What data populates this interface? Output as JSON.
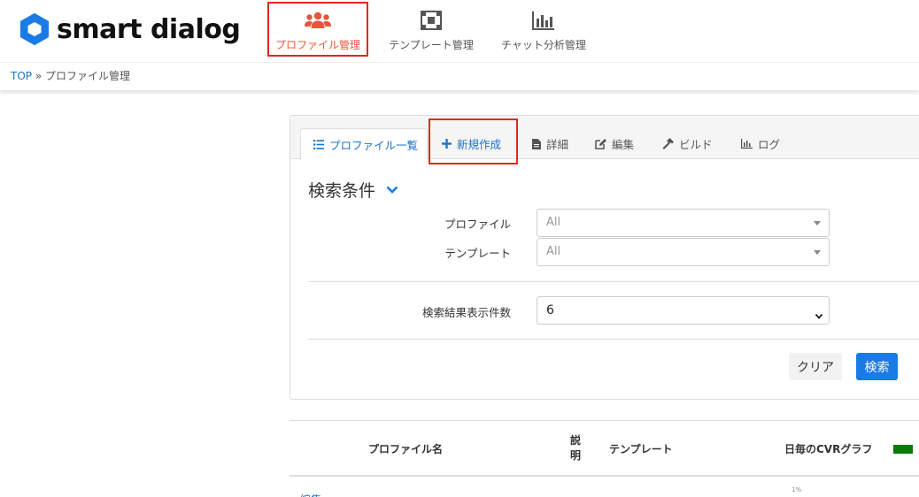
{
  "app": {
    "name": "smart dialog"
  },
  "nav": {
    "profile": "プロファイル管理",
    "template": "テンプレート管理",
    "chat": "チャット分析管理"
  },
  "breadcrumb": {
    "home": "TOP",
    "sep": "»",
    "current": "プロファイル管理"
  },
  "tabs": {
    "list": "プロファイル一覧",
    "new": "新規作成",
    "detail": "詳細",
    "edit": "編集",
    "build": "ビルド",
    "log": "ログ"
  },
  "search": {
    "title": "検索条件",
    "profile_label": "プロファイル",
    "profile_value": "All",
    "template_label": "テンプレート",
    "template_value": "All",
    "count_label": "検索結果表示件数",
    "count_value": "6",
    "clear_label": "クリア",
    "search_label": "検索"
  },
  "table": {
    "col_name": "プロファイル名",
    "col_desc": "説明",
    "col_template": "テンプレート",
    "col_graph": "日毎のCVRグラフ",
    "graph_pct": "1%",
    "row_edit": "編集"
  },
  "colors": {
    "accent": "#1a7be4",
    "highlight": "#e0281e",
    "nav_active": "#e8553c",
    "legend": "#0a7a0a"
  }
}
